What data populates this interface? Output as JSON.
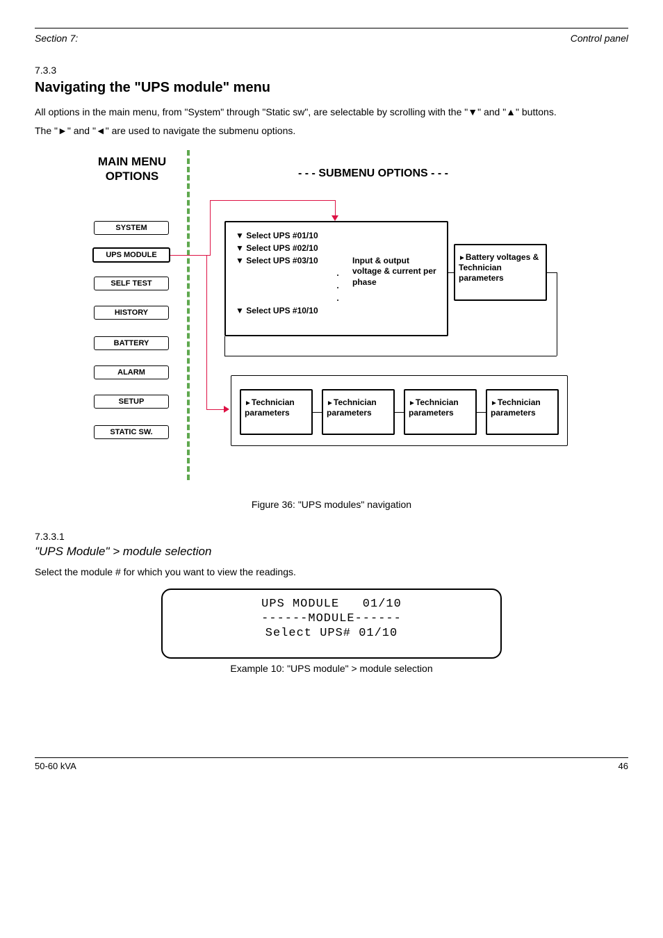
{
  "header": {
    "left": "Section 7:",
    "right": "Control panel"
  },
  "section": {
    "num": "7.3.3",
    "title": "Navigating the \"UPS module\" menu",
    "p1_a": "All options in the main menu, from \"System\" through \"Static sw\", are selectable by scrolling with the \"",
    "p1_b": "\" and \"",
    "p1_c": "\" buttons.",
    "p2_a": "The \"",
    "p2_b": "\" and \"",
    "p2_c": "\" are used to navigate the submenu options."
  },
  "diagram": {
    "main_heading": "MAIN MENU OPTIONS",
    "sub_heading": "- - -    SUBMENU OPTIONS   - - -",
    "menu_items": [
      "SYSTEM",
      "UPS MODULE",
      "SELF TEST",
      "HISTORY",
      "BATTERY",
      "ALARM",
      "SETUP",
      "STATIC SW."
    ],
    "ups_lines": [
      "▼ Select UPS #01/10",
      "▼ Select UPS #02/10",
      "▼ Select UPS #03/10"
    ],
    "ups_last": "▼ Select UPS #10/10",
    "io_text": "Input & output voltage & current per phase",
    "batt_text": "Battery voltages & Technician parameters",
    "tech_text": "Technician parameters"
  },
  "figure_caption": "Figure 36: \"UPS modules\" navigation",
  "subsection_num": "7.3.3.1",
  "subsection_title": "\"UPS Module\" > module selection",
  "subsection_text": "Select the module # for which you want to view the readings.",
  "lcd": {
    "l1": "UPS MODULE   01/10",
    "l2": "------MODULE------",
    "l3": "Select UPS# 01/10"
  },
  "ex_caption": "Example 10: \"UPS module\"  > module selection",
  "footer": {
    "left": "50-60 kVA",
    "right": "46"
  }
}
